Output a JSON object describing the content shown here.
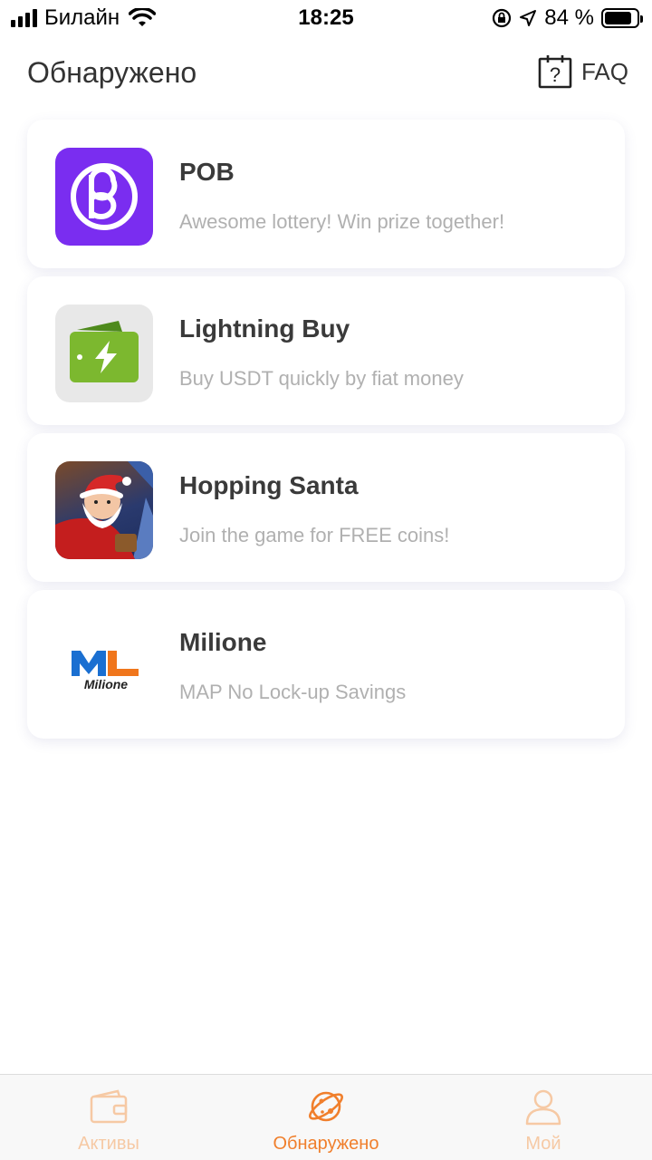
{
  "status_bar": {
    "carrier": "Билайн",
    "time": "18:25",
    "battery_percent": "84 %",
    "battery_level": 0.84
  },
  "header": {
    "title": "Обнаружено",
    "faq_label": "FAQ",
    "faq_icon": "calendar-question-icon"
  },
  "apps": [
    {
      "title": "POB",
      "subtitle": "Awesome lottery! Win prize together!",
      "icon": "pob-logo-icon"
    },
    {
      "title": "Lightning Buy",
      "subtitle": "Buy USDT quickly by fiat money",
      "icon": "wallet-lightning-icon"
    },
    {
      "title": "Hopping Santa",
      "subtitle": "Join the game for FREE coins!",
      "icon": "santa-icon"
    },
    {
      "title": "Milione",
      "subtitle": "MAP No Lock-up Savings",
      "icon": "milione-logo-icon"
    }
  ],
  "milione_logo": {
    "letters": "ML",
    "word": "Milione"
  },
  "tabbar": {
    "tabs": [
      {
        "label": "Активы",
        "icon": "wallet-icon",
        "active": false
      },
      {
        "label": "Обнаружено",
        "icon": "planet-icon",
        "active": true
      },
      {
        "label": "Мой",
        "icon": "user-icon",
        "active": false
      }
    ]
  },
  "colors": {
    "accent": "#f07f2c",
    "accent_inactive": "#f6c9a4",
    "pob_purple": "#7a2df0",
    "lightning_green": "#7cb82f"
  }
}
